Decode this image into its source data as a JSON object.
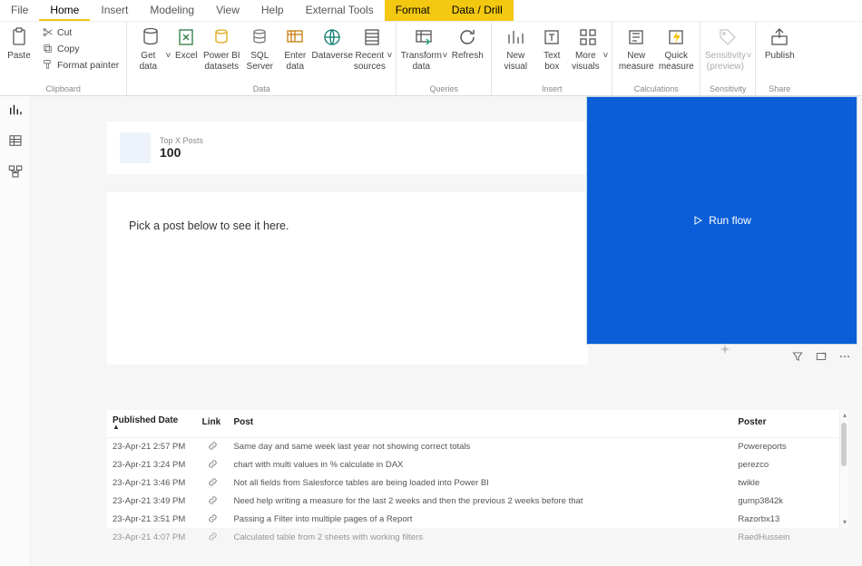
{
  "menu": {
    "items": [
      {
        "label": "File",
        "active": false,
        "highlight": false
      },
      {
        "label": "Home",
        "active": true,
        "highlight": false
      },
      {
        "label": "Insert",
        "active": false,
        "highlight": false
      },
      {
        "label": "Modeling",
        "active": false,
        "highlight": false
      },
      {
        "label": "View",
        "active": false,
        "highlight": false
      },
      {
        "label": "Help",
        "active": false,
        "highlight": false
      },
      {
        "label": "External Tools",
        "active": false,
        "highlight": false
      },
      {
        "label": "Format",
        "active": false,
        "highlight": true
      },
      {
        "label": "Data / Drill",
        "active": false,
        "highlight": true
      }
    ]
  },
  "ribbon": {
    "clipboard": {
      "paste": "Paste",
      "cut": "Cut",
      "copy": "Copy",
      "format_painter": "Format painter",
      "group": "Clipboard"
    },
    "data": {
      "get_data": "Get data",
      "excel": "Excel",
      "pbi_ds": "Power BI datasets",
      "sql": "SQL Server",
      "enter": "Enter data",
      "dataverse": "Dataverse",
      "recent": "Recent sources",
      "group": "Data"
    },
    "queries": {
      "transform": "Transform data",
      "refresh": "Refresh",
      "group": "Queries"
    },
    "insert": {
      "new_visual": "New visual",
      "text_box": "Text box",
      "more": "More visuals",
      "group": "Insert"
    },
    "calc": {
      "new_measure": "New measure",
      "quick": "Quick measure",
      "group": "Calculations"
    },
    "sens": {
      "label": "Sensitivity (preview)",
      "group": "Sensitivity"
    },
    "share": {
      "publish": "Publish",
      "group": "Share"
    }
  },
  "card_top": {
    "label": "Top X Posts",
    "value": "100"
  },
  "prompt": "Pick a post below to see it here.",
  "runflow_label": "Run flow",
  "table": {
    "headers": {
      "date": "Published Date",
      "link": "Link",
      "post": "Post",
      "poster": "Poster"
    },
    "rows": [
      {
        "date": "23-Apr-21 2:57 PM",
        "post": "Same day and same week last year not showing correct totals",
        "poster": "Powereports"
      },
      {
        "date": "23-Apr-21 3:24 PM",
        "post": "chart with multi values in % calculate in DAX",
        "poster": "perezco"
      },
      {
        "date": "23-Apr-21 3:46 PM",
        "post": "Not all fields from Salesforce tables are being loaded into Power BI",
        "poster": "twikle"
      },
      {
        "date": "23-Apr-21 3:49 PM",
        "post": "Need help writing a measure for the last 2 weeks and then the previous 2 weeks before that",
        "poster": "gump3842k"
      },
      {
        "date": "23-Apr-21 3:51 PM",
        "post": "Passing a Filter into multiple pages of a Report",
        "poster": "Razorbx13"
      },
      {
        "date": "23-Apr-21 4:07 PM",
        "post": "Calculated table from 2 sheets with working filters",
        "poster": "RaedHussein"
      }
    ]
  }
}
